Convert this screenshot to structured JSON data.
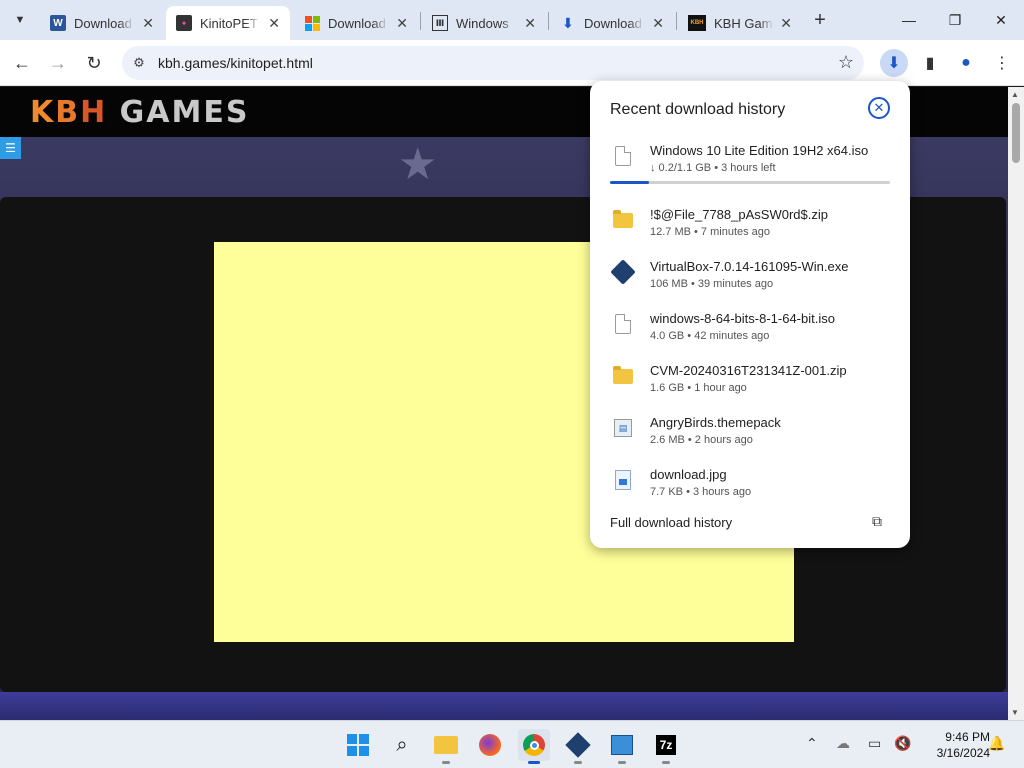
{
  "tabs": [
    {
      "title": "Download",
      "favicon": "word-icon",
      "active": false
    },
    {
      "title": "KinitoPET",
      "favicon": "kinito-icon",
      "active": true
    },
    {
      "title": "Download",
      "favicon": "microsoft-icon",
      "active": false
    },
    {
      "title": "Windows",
      "favicon": "archive-icon",
      "active": false
    },
    {
      "title": "Download",
      "favicon": "download-arrow-icon",
      "active": false
    },
    {
      "title": "KBH Games",
      "favicon": "kbh-icon",
      "active": false
    }
  ],
  "toolbar": {
    "url": "kbh.games/kinitopet.html"
  },
  "site": {
    "logo_k": "K",
    "logo_b": "B",
    "logo_h": "H",
    "logo_rest": " GAMES",
    "kbh_favicon_text": "KBH",
    "canvas_color": "#ffff99"
  },
  "downloads": {
    "title": "Recent download history",
    "items": [
      {
        "name": "Windows 10 Lite Edition 19H2 x64.iso",
        "meta": "↓ 0.2/1.1 GB • 3 hours left",
        "icon": "file-icon",
        "progress": 0.14
      },
      {
        "name": "!$@File_7788_pAsSW0rd$.zip",
        "meta": "12.7 MB • 7 minutes ago",
        "icon": "zip-folder-icon"
      },
      {
        "name": "VirtualBox-7.0.14-161095-Win.exe",
        "meta": "106 MB • 39 minutes ago",
        "icon": "virtualbox-icon"
      },
      {
        "name": "windows-8-64-bits-8-1-64-bit.iso",
        "meta": "4.0 GB • 42 minutes ago",
        "icon": "file-icon"
      },
      {
        "name": "CVM-20240316T231341Z-001.zip",
        "meta": "1.6 GB • 1 hour ago",
        "icon": "zip-folder-icon"
      },
      {
        "name": "AngryBirds.themepack",
        "meta": "2.6 MB • 2 hours ago",
        "icon": "themepack-icon"
      },
      {
        "name": "download.jpg",
        "meta": "7.7 KB • 3 hours ago",
        "icon": "image-file-icon"
      }
    ],
    "footer": "Full download history"
  },
  "taskbar": {
    "sevenzip_label": "7z",
    "time": "9:46 PM",
    "date": "3/16/2024"
  },
  "colors": {
    "accent": "#1a56c8",
    "tabstrip": "#dfe6f4"
  }
}
